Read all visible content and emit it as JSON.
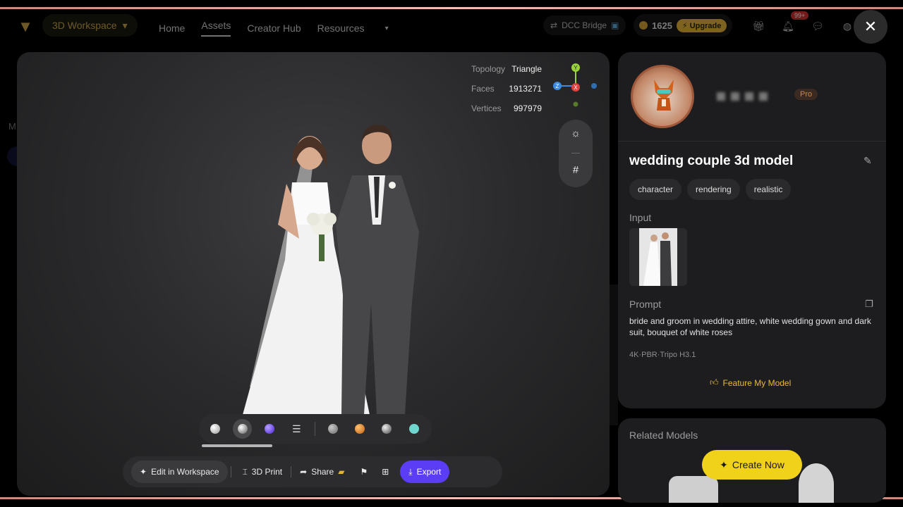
{
  "topbar": {
    "workspace_label": "3D Workspace",
    "nav": [
      "Home",
      "Assets",
      "Creator Hub",
      "Resources"
    ],
    "active_nav": "Assets",
    "dcc_label": "DCC Bridge",
    "credits": "1625",
    "upgrade_label": "Upgrade",
    "notif_badge": "99+"
  },
  "background": {
    "side_letter": "M"
  },
  "viewer": {
    "stats": [
      {
        "label": "Topology",
        "value": "Triangle"
      },
      {
        "label": "Faces",
        "value": "1913271"
      },
      {
        "label": "Vertices",
        "value": "997979"
      }
    ],
    "gizmo": {
      "y": "Y",
      "z": "Z",
      "x": "X"
    },
    "material_colors": [
      "#d8d8d8",
      "#c0c0c0",
      "#7b5cff",
      "#8a8a8a",
      "#e08a2a",
      "#9a9a9a",
      "#6fd6cf"
    ]
  },
  "actions": {
    "edit": "Edit in Workspace",
    "print": "3D Print",
    "share": "Share",
    "export": "Export"
  },
  "model": {
    "badge": "Pro",
    "title": "wedding couple 3d model",
    "tags": [
      "character",
      "rendering",
      "realistic"
    ],
    "input_label": "Input",
    "prompt_label": "Prompt",
    "prompt_text": "bride and groom in wedding attire, white wedding gown and dark suit, bouquet of white roses",
    "meta": "4K·PBR·Tripo H3.1",
    "feature_label": "Feature My Model"
  },
  "related": {
    "title": "Related Models",
    "create_label": "Create Now"
  }
}
